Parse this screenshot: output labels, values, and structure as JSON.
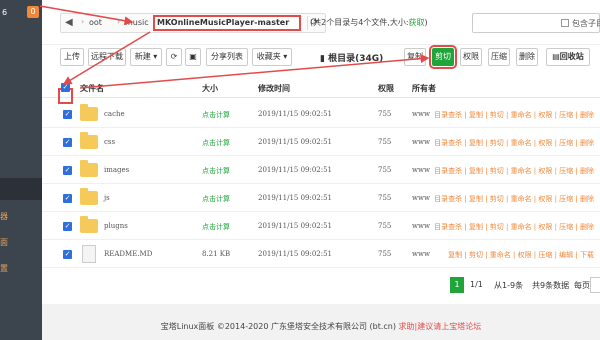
{
  "sidebar": {
    "version": "6",
    "badge": "0",
    "items": [
      "器",
      "面",
      "置"
    ]
  },
  "path": {
    "crumbs": [
      "oot",
      "music"
    ],
    "current": "MKOnlineMusicPlayer-master"
  },
  "summary": {
    "text": "(共2个目录与4个文件,大小:",
    "link": "获取",
    "end": ")"
  },
  "search": {
    "checkbox_label": "包含子目录"
  },
  "toolbar": {
    "upload": "上传",
    "remote_download": "远程下载",
    "new": "新建 ▾",
    "share_list": "分享列表",
    "favorites": "收藏夹 ▾",
    "root": "根目录(34G)",
    "copy": "复制",
    "cut": "剪切",
    "perm": "权限",
    "compress": "压缩",
    "delete": "删除",
    "recycle": "回收站"
  },
  "table": {
    "headers": {
      "name": "文件名",
      "size": "大小",
      "mtime": "修改时间",
      "perm": "权限",
      "owner": "所有者"
    },
    "rows": [
      {
        "name": "cache",
        "size": "点击计算",
        "mtime": "2019/11/15 09:02:51",
        "perm": "755",
        "owner": "www",
        "ops": "目录查杀 | 复制 | 剪切 | 重命名 | 权限 | 压缩 | 删除",
        "type": "folder"
      },
      {
        "name": "css",
        "size": "点击计算",
        "mtime": "2019/11/15 09:02:51",
        "perm": "755",
        "owner": "www",
        "ops": "目录查杀 | 复制 | 剪切 | 重命名 | 权限 | 压缩 | 删除",
        "type": "folder"
      },
      {
        "name": "images",
        "size": "点击计算",
        "mtime": "2019/11/15 09:02:51",
        "perm": "755",
        "owner": "www",
        "ops": "目录查杀 | 复制 | 剪切 | 重命名 | 权限 | 压缩 | 删除",
        "type": "folder"
      },
      {
        "name": "js",
        "size": "点击计算",
        "mtime": "2019/11/15 09:02:51",
        "perm": "755",
        "owner": "www",
        "ops": "目录查杀 | 复制 | 剪切 | 重命名 | 权限 | 压缩 | 删除",
        "type": "folder"
      },
      {
        "name": "plugns",
        "size": "点击计算",
        "mtime": "2019/11/15 09:02:51",
        "perm": "755",
        "owner": "www",
        "ops": "目录查杀 | 复制 | 剪切 | 重命名 | 权限 | 压缩 | 删除",
        "type": "folder"
      },
      {
        "name": "README.MD",
        "size": "8.21 KB",
        "mtime": "2019/11/15 09:02:51",
        "perm": "755",
        "owner": "www",
        "ops": "复制 | 剪切 | 重命名 | 权限 | 压缩 | 编辑 | 下载",
        "type": "file"
      }
    ]
  },
  "pager": {
    "current": "1",
    "pages": "1/1",
    "range": "从1-9条",
    "total": "共9条数据",
    "per_page": "每页"
  },
  "footer": {
    "copyright": "宝塔Linux面板 ©2014-2020 广东堡塔安全技术有限公司 (bt.cn)",
    "link": "求助|建议请上宝塔论坛"
  },
  "colors": {
    "accent": "#20a53a",
    "highlight": "#e34b4b",
    "ops": "#f0883a",
    "folder": "#f6c95b"
  }
}
